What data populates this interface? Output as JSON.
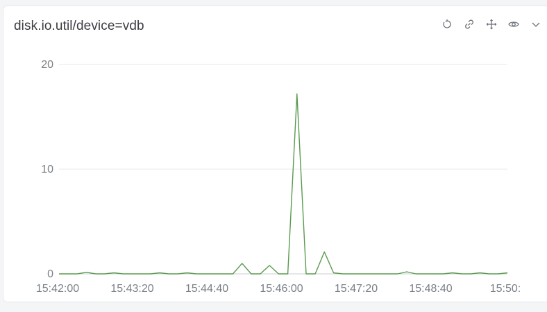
{
  "panel": {
    "title": "disk.io.util/device=vdb"
  },
  "toolbar": {
    "icons": [
      "refresh-icon",
      "link-icon",
      "move-icon",
      "eye-icon",
      "chevron-down-icon"
    ]
  },
  "colors": {
    "line": "#5a9a4f",
    "grid": "#e8eaed",
    "axis": "#c9ccd1",
    "text": "#7a7f87",
    "title": "#3a3d42"
  },
  "chart_data": {
    "type": "line",
    "title": "disk.io.util/device=vdb",
    "xlabel": "",
    "ylabel": "",
    "ylim": [
      0,
      20
    ],
    "y_ticks": [
      "0",
      "10",
      "20"
    ],
    "x_ticks": [
      "15:42:00",
      "15:43:20",
      "15:44:40",
      "15:46:00",
      "15:47:20",
      "15:48:40",
      "15:50:"
    ],
    "grid": true,
    "series": [
      {
        "values": [
          0,
          0,
          0,
          0.15,
          0,
          0,
          0.1,
          0,
          0,
          0,
          0,
          0.1,
          0,
          0,
          0.1,
          0,
          0,
          0,
          0,
          0,
          1.0,
          0,
          0,
          0.8,
          0,
          0,
          17.2,
          0,
          0,
          2.1,
          0.1,
          0,
          0,
          0,
          0,
          0,
          0,
          0,
          0.2,
          0,
          0,
          0,
          0,
          0.1,
          0,
          0,
          0.1,
          0,
          0,
          0.1
        ]
      }
    ]
  }
}
